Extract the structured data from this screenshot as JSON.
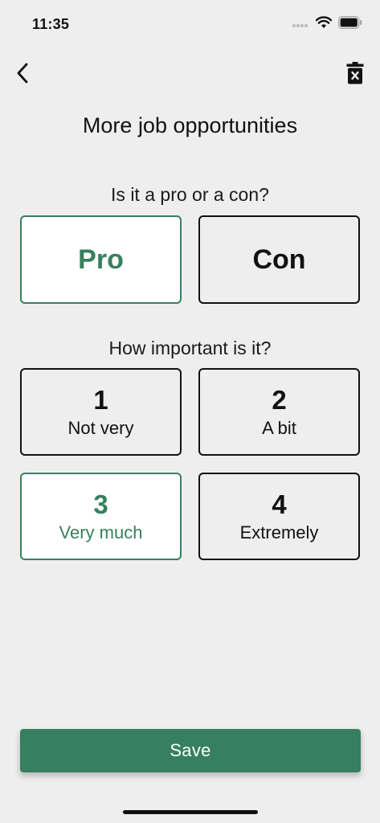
{
  "status_bar": {
    "time": "11:35"
  },
  "nav": {
    "back_icon": "chevron-left-icon",
    "delete_icon": "trash-icon"
  },
  "page": {
    "title": "More job opportunities"
  },
  "pro_con": {
    "question": "Is it a pro or a con?",
    "options": [
      {
        "label": "Pro",
        "selected": true
      },
      {
        "label": "Con",
        "selected": false
      }
    ]
  },
  "importance": {
    "question": "How important is it?",
    "options": [
      {
        "number": "1",
        "label": "Not very",
        "selected": false
      },
      {
        "number": "2",
        "label": "A bit",
        "selected": false
      },
      {
        "number": "3",
        "label": "Very much",
        "selected": true
      },
      {
        "number": "4",
        "label": "Extremely",
        "selected": false
      }
    ]
  },
  "actions": {
    "save_label": "Save"
  },
  "colors": {
    "accent": "#36805f",
    "background": "#eeeeee",
    "selected_background": "#ffffff",
    "border": "#111111"
  }
}
